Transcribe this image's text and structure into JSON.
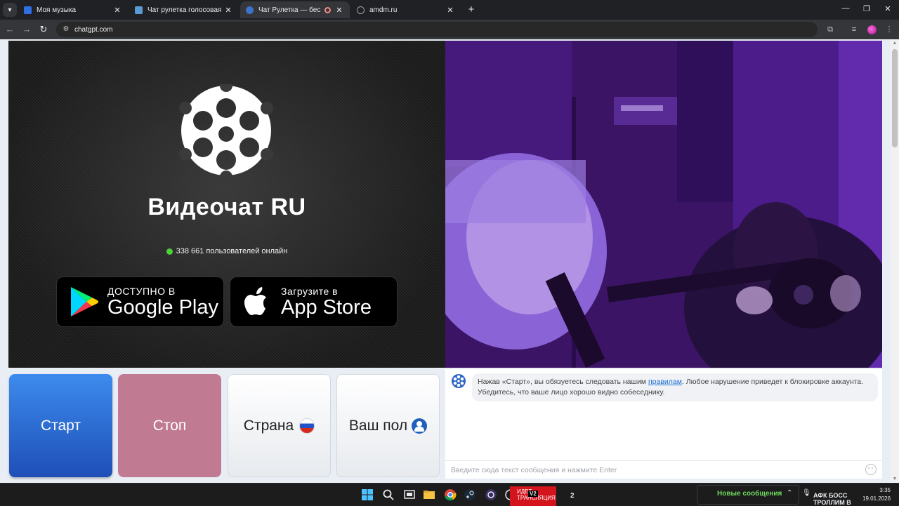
{
  "browser": {
    "tabs": [
      {
        "title": "Моя музыка",
        "favicon_color": "#2f6fe4"
      },
      {
        "title": "Чат рулетка голосовая — Neko",
        "favicon_color": "#5b9bd5"
      },
      {
        "title": "Чат Рулетка — бесплатный",
        "favicon_color": "#3d72c9",
        "active": true
      },
      {
        "title": "amdm.ru",
        "favicon_color": "#9aa0a6"
      }
    ],
    "url": "chatgpt.com"
  },
  "page": {
    "brand_title": "Видеочат RU",
    "online_text": "338 661 пользователей онлайн",
    "google_play": {
      "small": "ДОСТУПНО В",
      "big": "Google Play"
    },
    "app_store": {
      "small": "Загрузите в",
      "big": "App Store"
    },
    "controls": {
      "start": "Старт",
      "stop": "Стоп",
      "country": "Страна",
      "gender": "Ваш пол"
    },
    "chat": {
      "message_before_link": "Нажав «Старт», вы обязуетесь следовать нашим ",
      "message_link": "правилам",
      "message_after_link": ". Любое нарушение приведет к блокировке аккаунта. Убедитесь, что ваше лицо хорошо видно собеседнику.",
      "input_placeholder": "Введите сюда текст сообщения и нажмите Enter"
    }
  },
  "taskbar": {
    "red_app_text": "ИДЕТ ТРАНСЛЯЦИЯ",
    "v2_label": "V2",
    "count_label": "2",
    "notification": "Новые сообщения",
    "tray_text": "АФК БОСС ТРОЛЛИМ В",
    "time": "3:35",
    "date": "19.01.2026"
  },
  "colors": {
    "start_button": "#2f6fd8",
    "stop_button": "#c07a92",
    "online_dot": "#4cd137",
    "link": "#1a6fd1"
  }
}
